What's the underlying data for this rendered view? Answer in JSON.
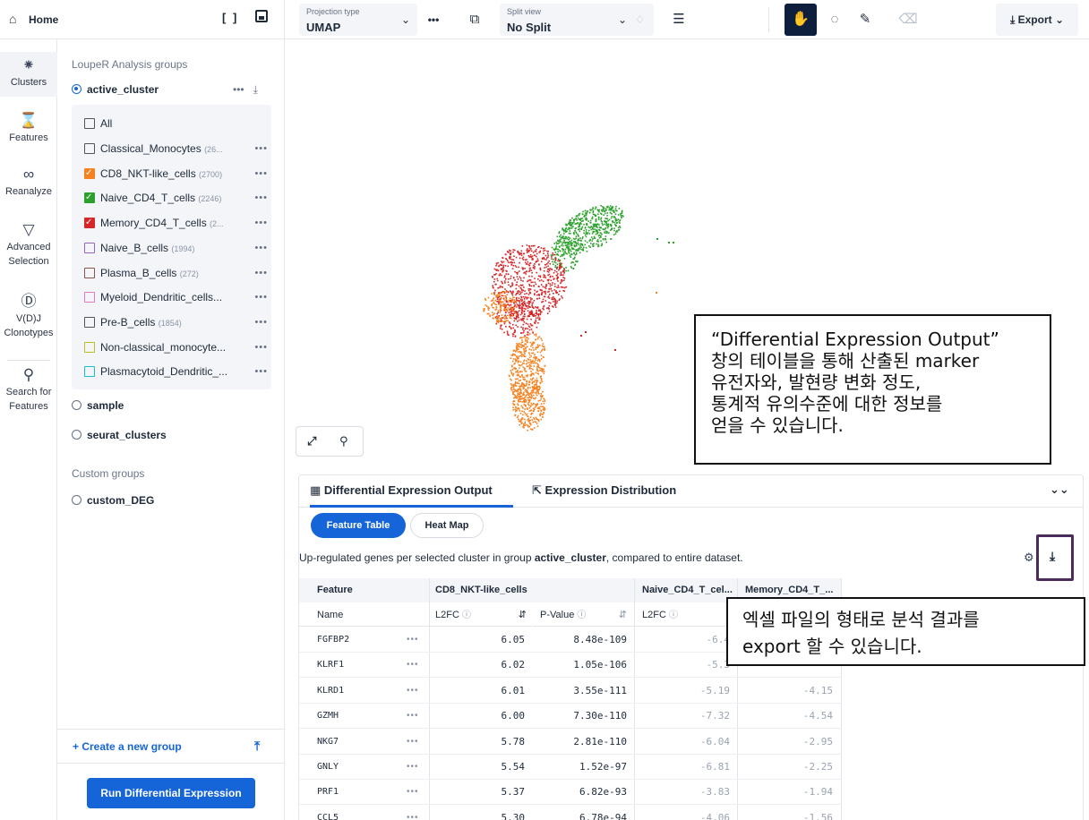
{
  "header": {
    "home_label": "Home",
    "projection_caption": "Projection type",
    "projection_value": "UMAP",
    "split_caption": "Split view",
    "split_value": "No Split",
    "export_label": "Export"
  },
  "rail": [
    {
      "label": "Clusters",
      "icon": "clusters-icon"
    },
    {
      "label": "Features",
      "icon": "features-icon"
    },
    {
      "label": "Reanalyze",
      "icon": "reanalyze-icon"
    },
    {
      "label": "Advanced Selection",
      "icon": "filter-icon"
    },
    {
      "label": "V(D)J Clonotypes",
      "icon": "vdj-icon"
    },
    {
      "label": "Search for Features",
      "icon": "search-icon"
    }
  ],
  "groups": {
    "section_title": "LoupeR Analysis groups",
    "active_group": "active_cluster",
    "all_label": "All",
    "clusters": [
      {
        "name": "Classical_Monocytes",
        "count": "(26...",
        "color": "#555555",
        "checked": false
      },
      {
        "name": "CD8_NKT-like_cells",
        "count": "(2700)",
        "color": "#f58220",
        "checked": true
      },
      {
        "name": "Naive_CD4_T_cells",
        "count": "(2246)",
        "color": "#2ca02c",
        "checked": true
      },
      {
        "name": "Memory_CD4_T_cells",
        "count": "(2...",
        "color": "#d62728",
        "checked": true
      },
      {
        "name": "Naive_B_cells",
        "count": "(1994)",
        "color": "#9467bd",
        "checked": false
      },
      {
        "name": "Plasma_B_cells",
        "count": "(272)",
        "color": "#8c564b",
        "checked": false
      },
      {
        "name": "Myeloid_Dendritic_cells...",
        "count": "",
        "color": "#e377c2",
        "checked": false
      },
      {
        "name": "Pre-B_cells",
        "count": "(1854)",
        "color": "#555555",
        "checked": false
      },
      {
        "name": "Non-classical_monocyte...",
        "count": "",
        "color": "#bcbd22",
        "checked": false
      },
      {
        "name": "Plasmacytoid_Dendritic_...",
        "count": "",
        "color": "#17becf",
        "checked": false
      }
    ],
    "other_groups": [
      "sample",
      "seurat_clusters"
    ],
    "custom_title": "Custom groups",
    "custom_groups": [
      "custom_DEG"
    ],
    "create_label": "+ Create a new group",
    "run_label": "Run Differential Expression"
  },
  "annotations": {
    "top": "“Differential Expression Output”\n창의 테이블을 통해 산출된 marker\n유전자와, 발현량 변화 정도,\n통계적 유의수준에 대한 정보를\n얻을 수 있습니다.",
    "bottom": "엑셀 파일의 형태로 분석 결과를\nexport 할 수 있습니다."
  },
  "panel": {
    "tab1": "Differential Expression Output",
    "tab2": "Expression Distribution",
    "pill_feature": "Feature Table",
    "pill_heatmap": "Heat Map",
    "summary_pre": "Up-regulated genes per selected cluster in group ",
    "summary_group": "active_cluster",
    "summary_post": ", compared to entire dataset.",
    "headers": {
      "feature": "Feature",
      "name": "Name",
      "group1": "CD8_NKT-like_cells",
      "group2": "Naive_CD4_T_cel...",
      "group3": "Memory_CD4_T_...",
      "l2fc": "L2FC",
      "pvalue": "P-Value"
    },
    "rows": [
      {
        "gene": "FGFBP2",
        "l2fc": "6.05",
        "p": "8.48e-109",
        "naive": "-6.4",
        "memory": ""
      },
      {
        "gene": "KLRF1",
        "l2fc": "6.02",
        "p": "1.05e-106",
        "naive": "-5.3",
        "memory": ""
      },
      {
        "gene": "KLRD1",
        "l2fc": "6.01",
        "p": "3.55e-111",
        "naive": "-5.19",
        "memory": "-4.15"
      },
      {
        "gene": "GZMH",
        "l2fc": "6.00",
        "p": "7.30e-110",
        "naive": "-7.32",
        "memory": "-4.54"
      },
      {
        "gene": "NKG7",
        "l2fc": "5.78",
        "p": "2.81e-110",
        "naive": "-6.04",
        "memory": "-2.95"
      },
      {
        "gene": "GNLY",
        "l2fc": "5.54",
        "p": "1.52e-97",
        "naive": "-6.81",
        "memory": "-2.25"
      },
      {
        "gene": "PRF1",
        "l2fc": "5.37",
        "p": "6.82e-93",
        "naive": "-3.83",
        "memory": "-1.94"
      },
      {
        "gene": "CCL5",
        "l2fc": "5.30",
        "p": "6.78e-94",
        "naive": "-4.06",
        "memory": "-1.56"
      }
    ]
  },
  "umap_colors": {
    "green": "#2ca02c",
    "red": "#d62728",
    "orange": "#f58220"
  }
}
